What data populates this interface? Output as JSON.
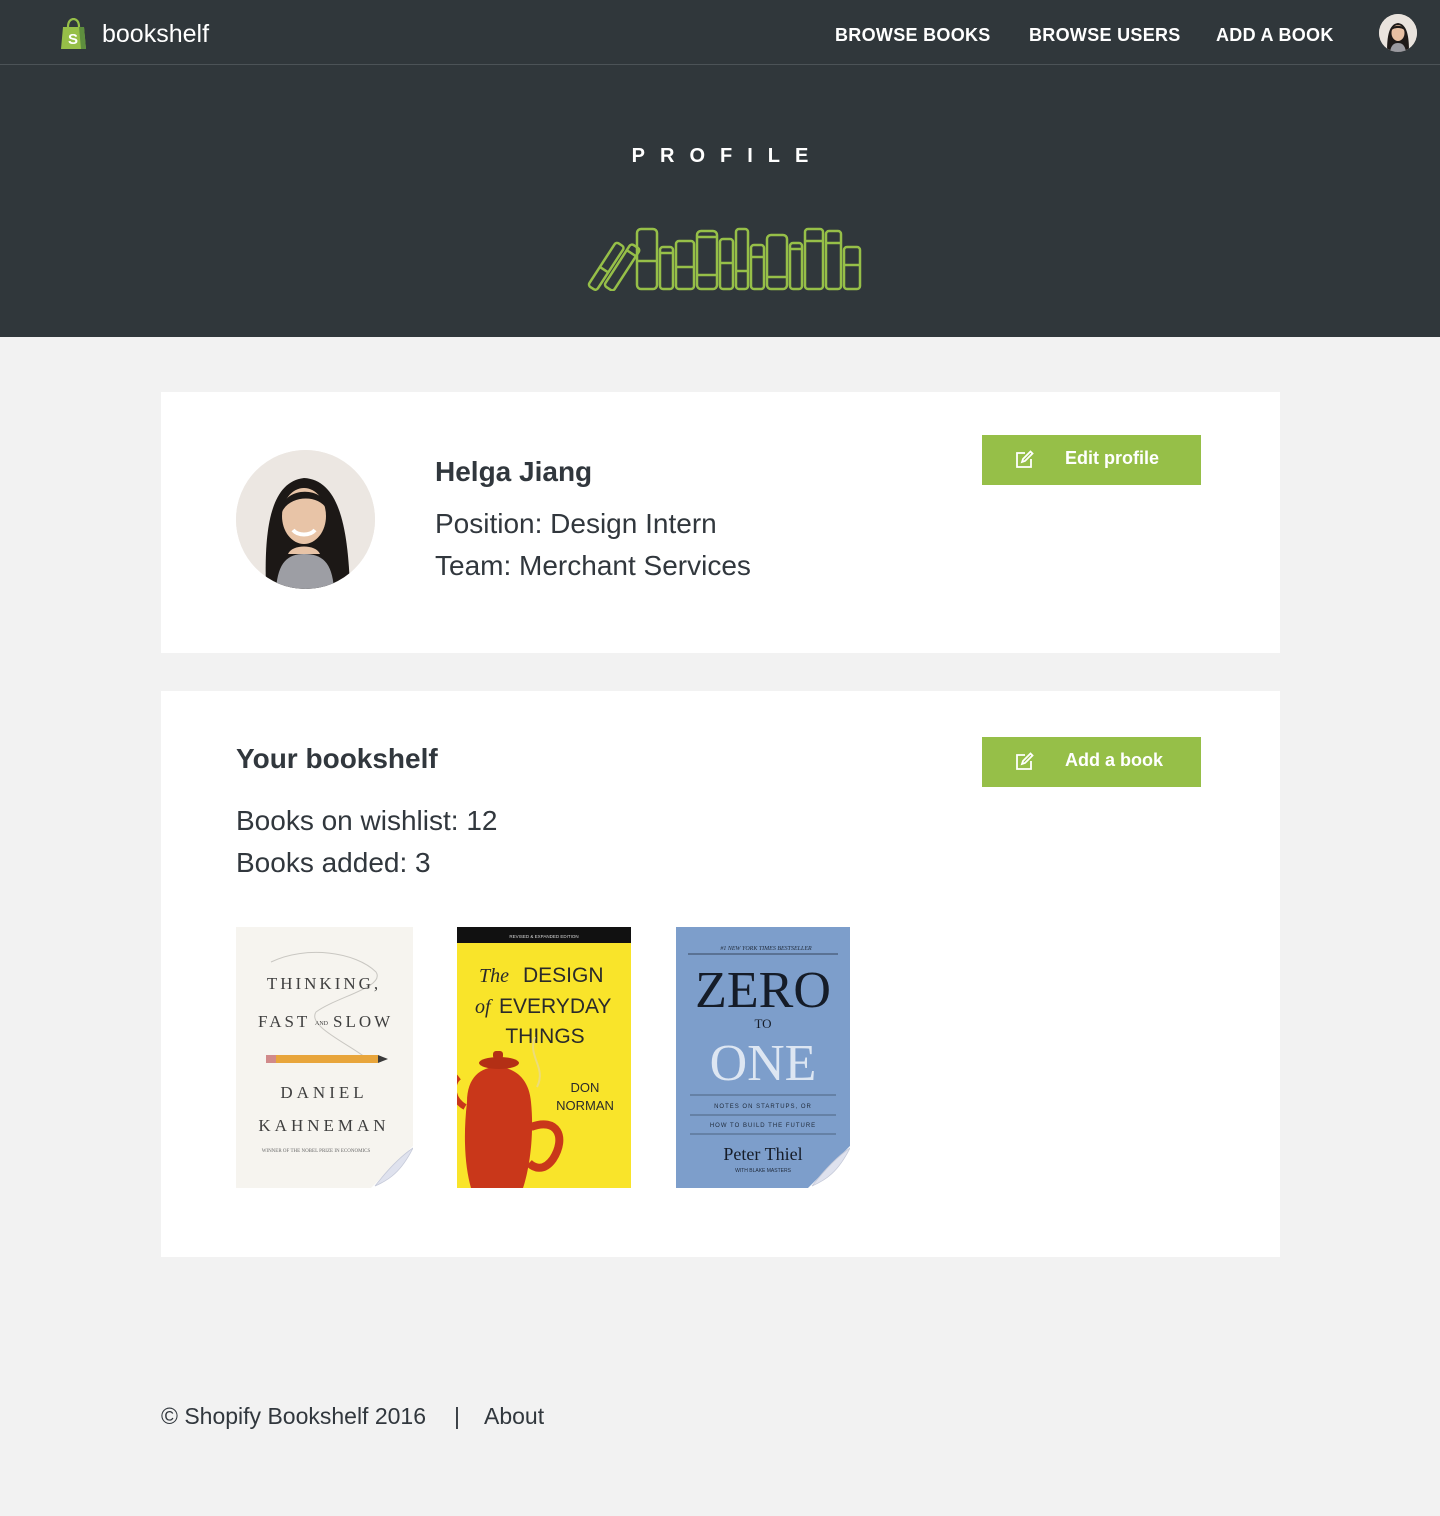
{
  "nav": {
    "brand": "bookshelf",
    "links": [
      "BROWSE BOOKS",
      "BROWSE USERS",
      "ADD A BOOK"
    ]
  },
  "hero": {
    "title": "PROFILE"
  },
  "profile": {
    "name": "Helga Jiang",
    "position": "Position: Design Intern",
    "team": "Team: Merchant Services",
    "edit_button": "Edit profile"
  },
  "bookshelf": {
    "title": "Your bookshelf",
    "wishlist": "Books on wishlist: 12",
    "added": "Books added: 3",
    "add_button": "Add a book",
    "books": [
      {
        "title_line1": "THINKING,",
        "title_line2a": "FAST",
        "title_line2b": "AND",
        "title_line2c": "SLOW",
        "author_line1": "DANIEL",
        "author_line2": "KAHNEMAN",
        "tagline": "WINNER OF THE NOBEL PRIZE IN ECONOMICS"
      },
      {
        "banner": "REVISED & EXPANDED EDITION",
        "line1a": "The",
        "line1b": "DESIGN",
        "line2a": "of",
        "line2b": "EVERYDAY",
        "line3": "THINGS",
        "author1": "DON",
        "author2": "NORMAN"
      },
      {
        "banner": "#1 NEW YORK TIMES BESTSELLER",
        "title1": "ZERO",
        "to": "TO",
        "title2": "ONE",
        "sub1": "NOTES ON STARTUPS, OR",
        "sub2": "HOW TO BUILD THE FUTURE",
        "author": "Peter Thiel",
        "coauthor": "WITH BLAKE MASTERS"
      }
    ]
  },
  "footer": {
    "copyright": "© Shopify Bookshelf 2016",
    "separator": "|",
    "about": "About"
  },
  "colors": {
    "dark": "#30373b",
    "accent": "#96bf48",
    "background": "#f2f2f2"
  },
  "icons": [
    "shopify-bag-icon",
    "edit-icon",
    "bookshelf-illustration"
  ]
}
